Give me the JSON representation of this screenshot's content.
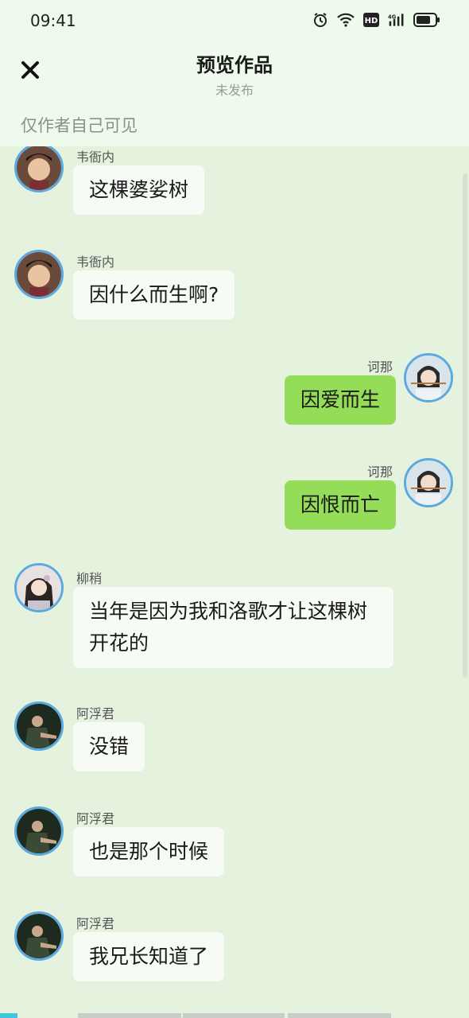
{
  "status_bar": {
    "time": "09:41",
    "icons": [
      "alarm-icon",
      "wifi-icon",
      "hd-icon",
      "signal-4g-icon",
      "battery-icon"
    ],
    "hd_text": "HD",
    "net_text": "4G"
  },
  "header": {
    "close_icon": "close-icon",
    "title": "预览作品",
    "subtitle": "未发布",
    "visibility": "仅作者自己可见"
  },
  "messages": [
    {
      "side": "left",
      "name": "韦衙内",
      "text": "这棵婆娑树"
    },
    {
      "side": "left",
      "name": "韦衙内",
      "text": "因什么而生啊?"
    },
    {
      "side": "right",
      "name": "诃那",
      "text": "因爱而生"
    },
    {
      "side": "right",
      "name": "诃那",
      "text": "因恨而亡"
    },
    {
      "side": "left",
      "name": "柳稍",
      "text": "当年是因为我和洛歌才让这棵树开花的"
    },
    {
      "side": "left",
      "name": "阿浮君",
      "text": "没错"
    },
    {
      "side": "left",
      "name": "阿浮君",
      "text": "也是那个时候"
    },
    {
      "side": "left",
      "name": "阿浮君",
      "text": "我兄长知道了"
    }
  ],
  "colors": {
    "background": "#e4f2de",
    "header_bg": "#eefbec",
    "left_bubble": "#f7fbf5",
    "right_bubble": "#95dc58",
    "avatar_ring": "#5aa9e0",
    "active_tab": "#3cc7dc"
  }
}
